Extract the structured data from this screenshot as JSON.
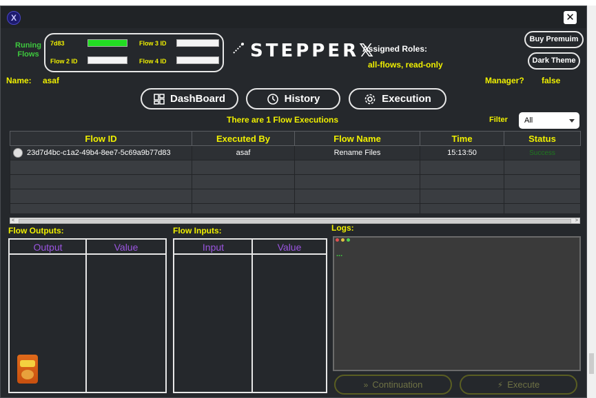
{
  "window": {
    "app_icon": "X",
    "close_symbol": "✕"
  },
  "running_flows": {
    "label": "Runing Flows",
    "slots": [
      {
        "label": "7d83",
        "progress": 1.0
      },
      {
        "label": "Flow 3 ID",
        "progress": 0
      },
      {
        "label": "Flow 2 ID",
        "progress": 0
      },
      {
        "label": "Flow 4 ID",
        "progress": 0
      }
    ]
  },
  "logo": {
    "text": "STEPPER𝕏",
    "icon": "sparkle-icon"
  },
  "roles": {
    "label": "Assigned Roles:",
    "value": "all-flows, read-only"
  },
  "buttons": {
    "buy_premium": "Buy Premuim",
    "dark_theme": "Dark Theme"
  },
  "user": {
    "name_label": "Name:",
    "name_value": "asaf",
    "manager_label": "Manager?",
    "manager_value": "false"
  },
  "nav": [
    {
      "label": "DashBoard",
      "icon": "dashboard-icon"
    },
    {
      "label": "History",
      "icon": "history-icon"
    },
    {
      "label": "Execution",
      "icon": "execution-gear-icon"
    }
  ],
  "summary": "There are 1 Flow Executions",
  "filter": {
    "label": "Filter",
    "value": "All"
  },
  "table": {
    "headers": [
      "Flow ID",
      "Executed By",
      "Flow Name",
      "Time",
      "Status"
    ],
    "rows": [
      {
        "flow_id": "23d7d4bc-c1a2-49b4-8ee7-5c69a9b77d83",
        "executed_by": "asaf",
        "flow_name": "Rename Files",
        "time": "15:13:50",
        "status": "Success"
      }
    ]
  },
  "outputs": {
    "label": "Flow Outputs:",
    "col1": "Output",
    "col2": "Value"
  },
  "inputs": {
    "label": "Flow Inputs:",
    "col1": "Input",
    "col2": "Value"
  },
  "logs": {
    "label": "Logs:",
    "content": "..."
  },
  "actions": {
    "continuation": "Continuation",
    "execute": "Execute"
  },
  "colors": {
    "accent_yellow": "#f0f000",
    "accent_green": "#3ec93e",
    "header_purple": "#9b55e0",
    "background": "#25282c"
  }
}
